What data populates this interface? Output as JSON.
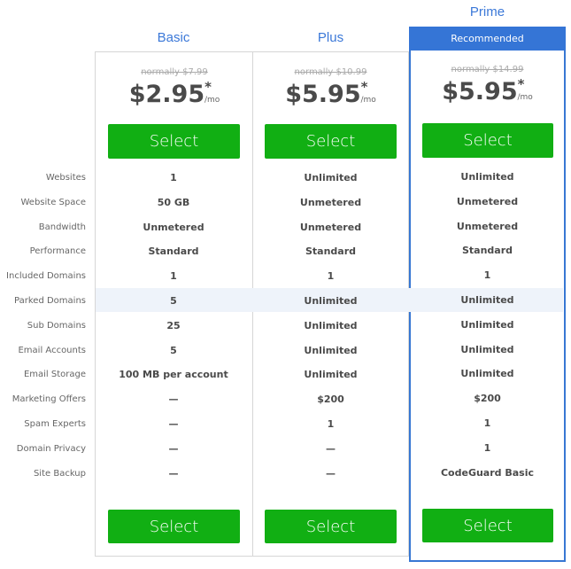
{
  "plans": [
    {
      "name": "Basic",
      "normally": "normally $7.99",
      "price": "$2.95",
      "asterisk": "*",
      "per": "/mo",
      "select_label": "Select",
      "recommended": false,
      "features": [
        "1",
        "50 GB",
        "Unmetered",
        "Standard",
        "1",
        "5",
        "25",
        "5",
        "100 MB per account",
        "—",
        "—",
        "—",
        "—"
      ]
    },
    {
      "name": "Plus",
      "normally": "normally $10.99",
      "price": "$5.95",
      "asterisk": "*",
      "per": "/mo",
      "select_label": "Select",
      "recommended": false,
      "features": [
        "Unlimited",
        "Unmetered",
        "Unmetered",
        "Standard",
        "1",
        "Unlimited",
        "Unlimited",
        "Unlimited",
        "Unlimited",
        "$200",
        "1",
        "—",
        "—"
      ]
    },
    {
      "name": "Prime",
      "badge": "Recommended",
      "normally": "normally $14.99",
      "price": "$5.95",
      "asterisk": "*",
      "per": "/mo",
      "select_label": "Select",
      "recommended": true,
      "features": [
        "Unlimited",
        "Unmetered",
        "Unmetered",
        "Standard",
        "1",
        "Unlimited",
        "Unlimited",
        "Unlimited",
        "Unlimited",
        "$200",
        "1",
        "1",
        "CodeGuard Basic"
      ]
    }
  ],
  "feature_labels": [
    "Websites",
    "Website Space",
    "Bandwidth",
    "Performance",
    "Included Domains",
    "Parked Domains",
    "Sub Domains",
    "Email Accounts",
    "Email Storage",
    "Marketing Offers",
    "Spam Experts",
    "Domain Privacy",
    "Site Backup"
  ],
  "highlighted_row": "Parked Domains",
  "colors": {
    "accent_blue": "#3575d6",
    "select_green": "#11af13",
    "row_highlight": "#eef3fa"
  }
}
